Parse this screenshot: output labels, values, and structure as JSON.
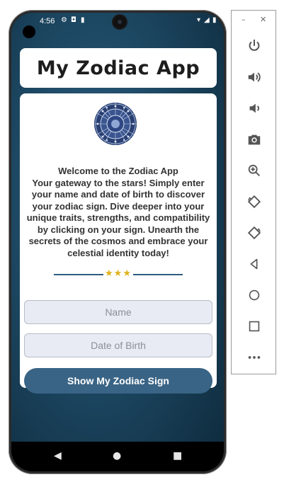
{
  "status": {
    "time": "4:56"
  },
  "app": {
    "title": "My Zodiac App"
  },
  "intro": {
    "heading": "Welcome to the Zodiac App",
    "body": "Your gateway to the stars! Simply enter your name and date of birth to discover your zodiac sign. Dive deeper into your unique traits, strengths, and compatibility by clicking on your sign. Unearth the secrets of the cosmos and embrace your celestial identity today!"
  },
  "form": {
    "name_placeholder": "Name",
    "dob_placeholder": "Date of Birth",
    "submit_label": "Show My Zodiac Sign"
  },
  "divider": {
    "stars": "★★★"
  },
  "colors": {
    "accent": "#3a6485",
    "star": "#e0b21a",
    "background": "#1d4863"
  },
  "icons": {
    "status": [
      "gear-icon",
      "record-icon",
      "sd-card-icon",
      "wifi-icon",
      "signal-icon",
      "battery-icon"
    ],
    "nav": [
      "back-icon",
      "home-icon",
      "recents-icon"
    ],
    "emulator_panel": [
      "power-icon",
      "volume-up-icon",
      "volume-down-icon",
      "camera-icon",
      "zoom-icon",
      "rotate-left-icon",
      "rotate-right-icon",
      "back-icon",
      "home-icon",
      "overview-icon",
      "more-icon"
    ]
  }
}
